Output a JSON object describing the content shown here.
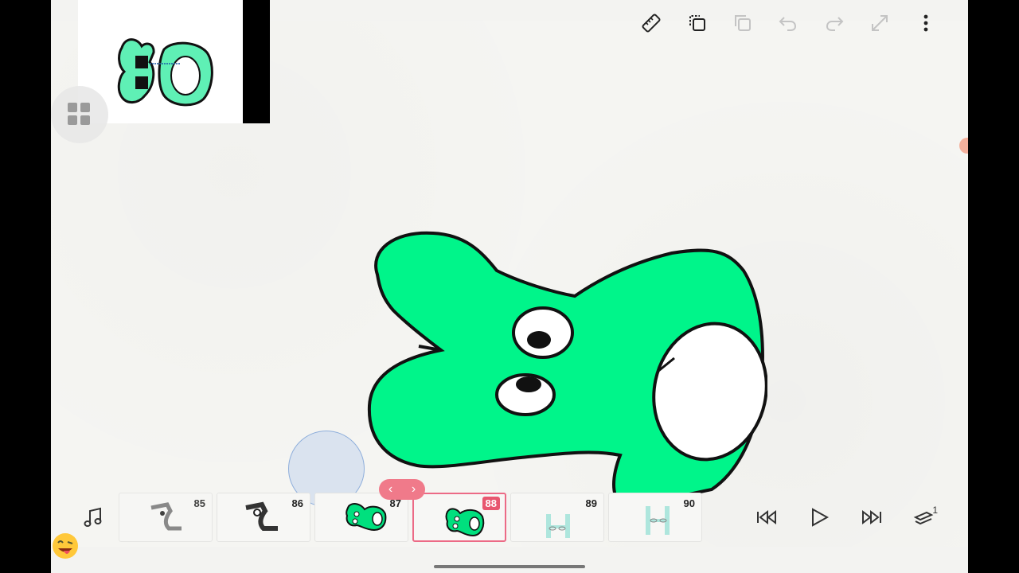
{
  "toolbar": {
    "icons": [
      "ruler-icon",
      "copy-layer-icon",
      "duplicate-icon",
      "undo-icon",
      "redo-icon",
      "expand-icon",
      "more-options-icon"
    ]
  },
  "reference": {
    "label": "80"
  },
  "timeline": {
    "frames": [
      {
        "number": "85"
      },
      {
        "number": "86"
      },
      {
        "number": "87"
      },
      {
        "number": "88",
        "active": true
      },
      {
        "number": "89"
      },
      {
        "number": "90"
      }
    ],
    "layer_count": "1"
  },
  "colors": {
    "character_green": "#00f58a",
    "accent_pink": "#e8566f",
    "outline": "#111111"
  }
}
